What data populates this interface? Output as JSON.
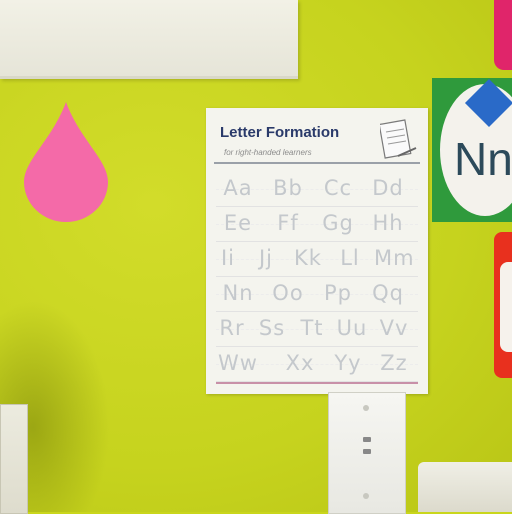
{
  "chart": {
    "title": "Letter Formation",
    "subtitle": "for right-handed learners",
    "rows": [
      [
        "Aa",
        "Bb",
        "Cc",
        "Dd"
      ],
      [
        "Ee",
        "Ff",
        "Gg",
        "Hh"
      ],
      [
        "Ii",
        "Jj",
        "Kk",
        "Ll",
        "Mm"
      ],
      [
        "Nn",
        "Oo",
        "Pp",
        "Qq"
      ],
      [
        "Rr",
        "Ss",
        "Tt",
        "Uu",
        "Vv"
      ],
      [
        "Ww",
        "Xx",
        "Yy",
        "Zz"
      ]
    ]
  },
  "poster": {
    "letters": "Nn"
  },
  "colors": {
    "wall": "#c9d61c",
    "drop": "#f46aa8",
    "poster_border": "#2f9a3c",
    "title": "#2a3a6a"
  }
}
